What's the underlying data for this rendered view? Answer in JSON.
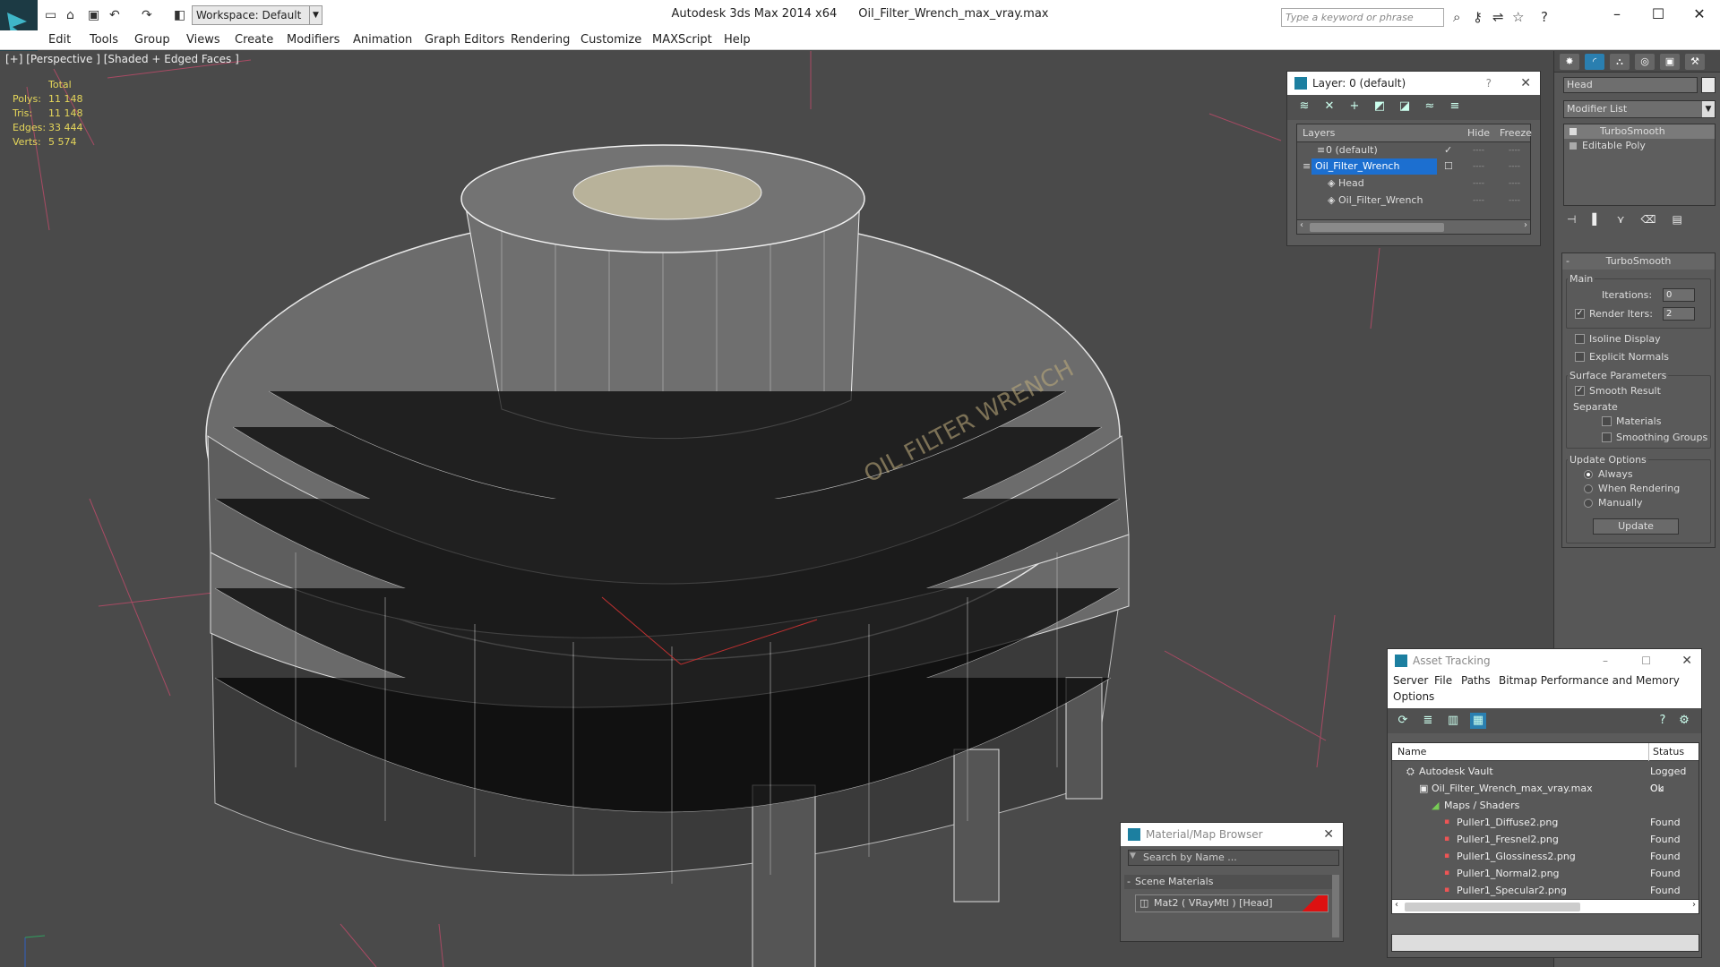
{
  "titlebar": {
    "workspace": "Workspace: Default",
    "app_name": "Autodesk 3ds Max  2014 x64",
    "file_name": "Oil_Filter_Wrench_max_vray.max",
    "search_placeholder": "Type a keyword or phrase"
  },
  "menu": [
    "Edit",
    "Tools",
    "Group",
    "Views",
    "Create",
    "Modifiers",
    "Animation",
    "Graph Editors",
    "Rendering",
    "Customize",
    "MAXScript",
    "Help"
  ],
  "viewport": {
    "label": "[+] [Perspective ] [Shaded + Edged Faces ]",
    "stats": {
      "header": "Total",
      "polys_label": "Polys:",
      "polys": "11 148",
      "tris_label": "Tris:",
      "tris": "11 148",
      "edges_label": "Edges:",
      "edges": "33 444",
      "verts_label": "Verts:",
      "verts": "5 574"
    }
  },
  "layer_window": {
    "title": "Layer: 0 (default)",
    "help": "?",
    "col_layers": "Layers",
    "col_hide": "Hide",
    "col_freeze": "Freeze",
    "rows": [
      "0 (default)",
      "Oil_Filter_Wrench",
      "Head",
      "Oil_Filter_Wrench"
    ]
  },
  "command_panel": {
    "object_name": "Head",
    "modifier_list": "Modifier List",
    "stack": [
      "TurboSmooth",
      "Editable Poly"
    ],
    "turbosmooth": {
      "title": "TurboSmooth",
      "main": "Main",
      "iterations_label": "Iterations:",
      "iterations": "0",
      "render_iters_label": "Render Iters:",
      "render_iters": "2",
      "isoline": "Isoline Display",
      "explicit_normals": "Explicit Normals",
      "surface_params": "Surface Parameters",
      "smooth_result": "Smooth Result",
      "separate": "Separate",
      "materials": "Materials",
      "smoothing_groups": "Smoothing Groups",
      "update_options": "Update Options",
      "always": "Always",
      "when_rendering": "When Rendering",
      "manually": "Manually",
      "update_btn": "Update"
    }
  },
  "asset_window": {
    "title": "Asset Tracking",
    "menu": [
      "Server",
      "File",
      "Paths",
      "Bitmap Performance and Memory",
      "Options"
    ],
    "col_name": "Name",
    "col_status": "Status",
    "rows": [
      {
        "name": "Autodesk Vault",
        "status": "Logged Ou"
      },
      {
        "name": "Oil_Filter_Wrench_max_vray.max",
        "status": "Ok"
      },
      {
        "name": "Maps / Shaders",
        "status": ""
      },
      {
        "name": "Puller1_Diffuse2.png",
        "status": "Found"
      },
      {
        "name": "Puller1_Fresnel2.png",
        "status": "Found"
      },
      {
        "name": "Puller1_Glossiness2.png",
        "status": "Found"
      },
      {
        "name": "Puller1_Normal2.png",
        "status": "Found"
      },
      {
        "name": "Puller1_Specular2.png",
        "status": "Found"
      }
    ]
  },
  "material_browser": {
    "title": "Material/Map Browser",
    "search_placeholder": "Search by Name ...",
    "section": "Scene Materials",
    "item": "Mat2  ( VRayMtl )  [Head]"
  },
  "colors": {
    "selection": "#1c6fd0",
    "stats_text": "#e6d75a",
    "viewport_bg": "#4a4a4a"
  }
}
